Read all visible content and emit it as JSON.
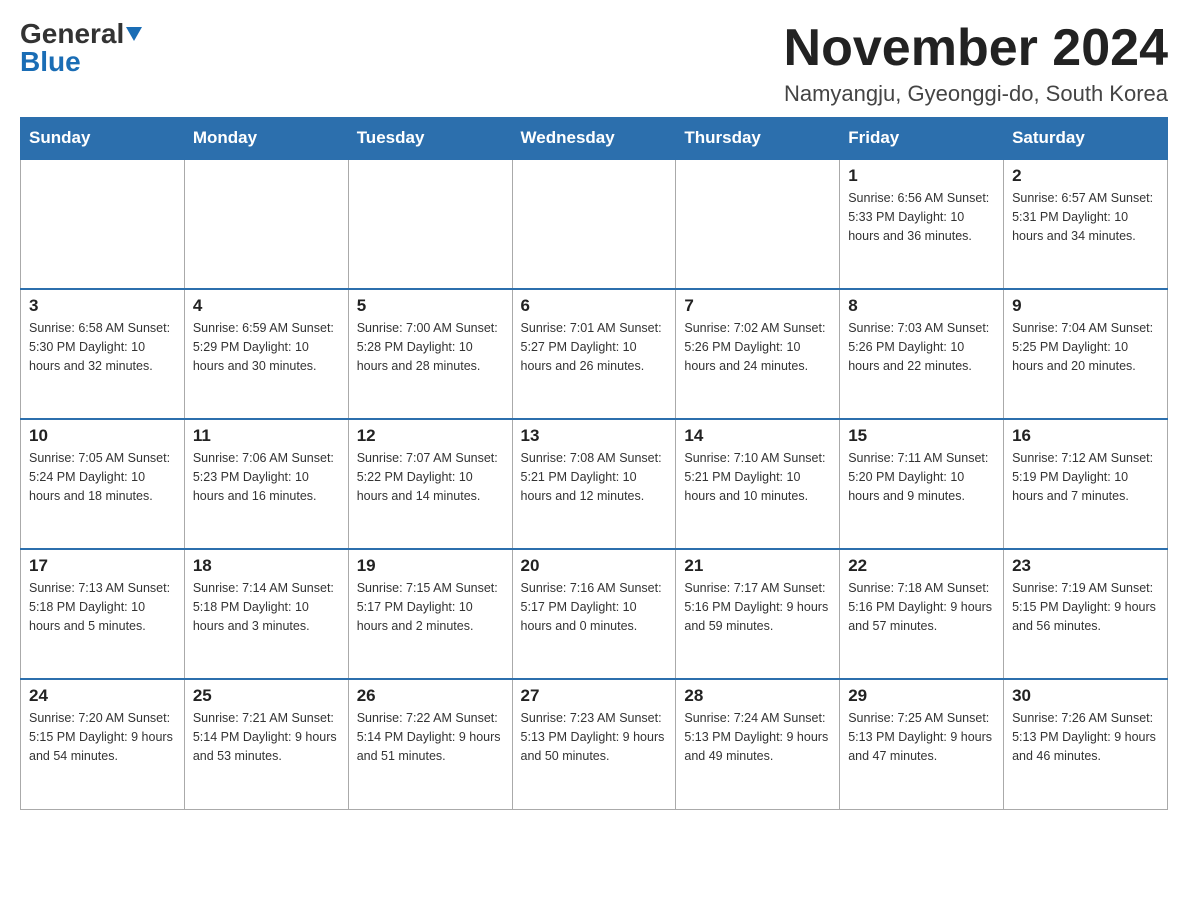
{
  "header": {
    "logo_general": "General",
    "logo_blue": "Blue",
    "month_year": "November 2024",
    "location": "Namyangju, Gyeonggi-do, South Korea"
  },
  "days_of_week": [
    "Sunday",
    "Monday",
    "Tuesday",
    "Wednesday",
    "Thursday",
    "Friday",
    "Saturday"
  ],
  "weeks": [
    {
      "days": [
        {
          "number": "",
          "info": ""
        },
        {
          "number": "",
          "info": ""
        },
        {
          "number": "",
          "info": ""
        },
        {
          "number": "",
          "info": ""
        },
        {
          "number": "",
          "info": ""
        },
        {
          "number": "1",
          "info": "Sunrise: 6:56 AM\nSunset: 5:33 PM\nDaylight: 10 hours and 36 minutes."
        },
        {
          "number": "2",
          "info": "Sunrise: 6:57 AM\nSunset: 5:31 PM\nDaylight: 10 hours and 34 minutes."
        }
      ]
    },
    {
      "days": [
        {
          "number": "3",
          "info": "Sunrise: 6:58 AM\nSunset: 5:30 PM\nDaylight: 10 hours and 32 minutes."
        },
        {
          "number": "4",
          "info": "Sunrise: 6:59 AM\nSunset: 5:29 PM\nDaylight: 10 hours and 30 minutes."
        },
        {
          "number": "5",
          "info": "Sunrise: 7:00 AM\nSunset: 5:28 PM\nDaylight: 10 hours and 28 minutes."
        },
        {
          "number": "6",
          "info": "Sunrise: 7:01 AM\nSunset: 5:27 PM\nDaylight: 10 hours and 26 minutes."
        },
        {
          "number": "7",
          "info": "Sunrise: 7:02 AM\nSunset: 5:26 PM\nDaylight: 10 hours and 24 minutes."
        },
        {
          "number": "8",
          "info": "Sunrise: 7:03 AM\nSunset: 5:26 PM\nDaylight: 10 hours and 22 minutes."
        },
        {
          "number": "9",
          "info": "Sunrise: 7:04 AM\nSunset: 5:25 PM\nDaylight: 10 hours and 20 minutes."
        }
      ]
    },
    {
      "days": [
        {
          "number": "10",
          "info": "Sunrise: 7:05 AM\nSunset: 5:24 PM\nDaylight: 10 hours and 18 minutes."
        },
        {
          "number": "11",
          "info": "Sunrise: 7:06 AM\nSunset: 5:23 PM\nDaylight: 10 hours and 16 minutes."
        },
        {
          "number": "12",
          "info": "Sunrise: 7:07 AM\nSunset: 5:22 PM\nDaylight: 10 hours and 14 minutes."
        },
        {
          "number": "13",
          "info": "Sunrise: 7:08 AM\nSunset: 5:21 PM\nDaylight: 10 hours and 12 minutes."
        },
        {
          "number": "14",
          "info": "Sunrise: 7:10 AM\nSunset: 5:21 PM\nDaylight: 10 hours and 10 minutes."
        },
        {
          "number": "15",
          "info": "Sunrise: 7:11 AM\nSunset: 5:20 PM\nDaylight: 10 hours and 9 minutes."
        },
        {
          "number": "16",
          "info": "Sunrise: 7:12 AM\nSunset: 5:19 PM\nDaylight: 10 hours and 7 minutes."
        }
      ]
    },
    {
      "days": [
        {
          "number": "17",
          "info": "Sunrise: 7:13 AM\nSunset: 5:18 PM\nDaylight: 10 hours and 5 minutes."
        },
        {
          "number": "18",
          "info": "Sunrise: 7:14 AM\nSunset: 5:18 PM\nDaylight: 10 hours and 3 minutes."
        },
        {
          "number": "19",
          "info": "Sunrise: 7:15 AM\nSunset: 5:17 PM\nDaylight: 10 hours and 2 minutes."
        },
        {
          "number": "20",
          "info": "Sunrise: 7:16 AM\nSunset: 5:17 PM\nDaylight: 10 hours and 0 minutes."
        },
        {
          "number": "21",
          "info": "Sunrise: 7:17 AM\nSunset: 5:16 PM\nDaylight: 9 hours and 59 minutes."
        },
        {
          "number": "22",
          "info": "Sunrise: 7:18 AM\nSunset: 5:16 PM\nDaylight: 9 hours and 57 minutes."
        },
        {
          "number": "23",
          "info": "Sunrise: 7:19 AM\nSunset: 5:15 PM\nDaylight: 9 hours and 56 minutes."
        }
      ]
    },
    {
      "days": [
        {
          "number": "24",
          "info": "Sunrise: 7:20 AM\nSunset: 5:15 PM\nDaylight: 9 hours and 54 minutes."
        },
        {
          "number": "25",
          "info": "Sunrise: 7:21 AM\nSunset: 5:14 PM\nDaylight: 9 hours and 53 minutes."
        },
        {
          "number": "26",
          "info": "Sunrise: 7:22 AM\nSunset: 5:14 PM\nDaylight: 9 hours and 51 minutes."
        },
        {
          "number": "27",
          "info": "Sunrise: 7:23 AM\nSunset: 5:13 PM\nDaylight: 9 hours and 50 minutes."
        },
        {
          "number": "28",
          "info": "Sunrise: 7:24 AM\nSunset: 5:13 PM\nDaylight: 9 hours and 49 minutes."
        },
        {
          "number": "29",
          "info": "Sunrise: 7:25 AM\nSunset: 5:13 PM\nDaylight: 9 hours and 47 minutes."
        },
        {
          "number": "30",
          "info": "Sunrise: 7:26 AM\nSunset: 5:13 PM\nDaylight: 9 hours and 46 minutes."
        }
      ]
    }
  ]
}
